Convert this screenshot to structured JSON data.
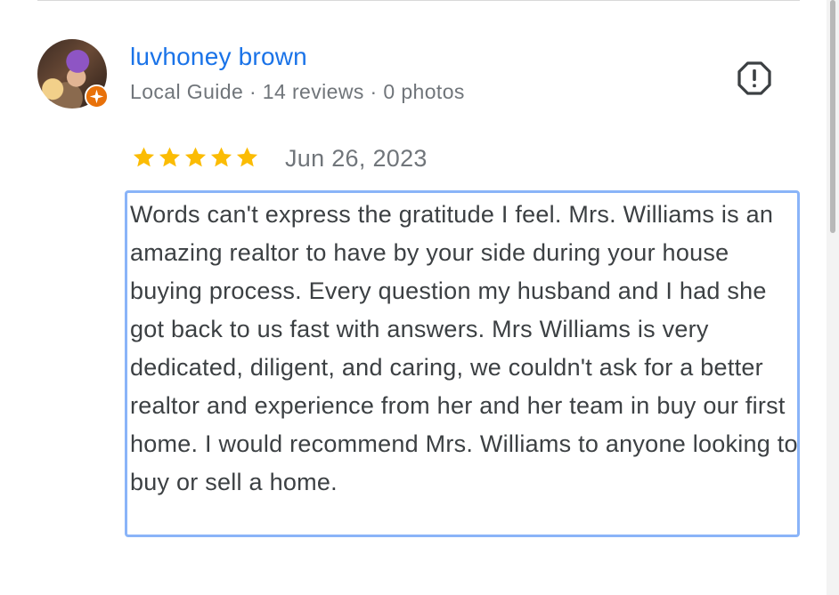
{
  "review": {
    "reviewer_name": "luvhoney brown",
    "reviewer_meta": "Local Guide · 14 reviews · 0 photos",
    "rating": 5,
    "rating_max": 5,
    "date": "Jun 26, 2023",
    "text": "Words can't express the gratitude I feel. Mrs. Williams is an amazing realtor to have by your side during your house buying process. Every question my husband and I had she got back to us fast with answers. Mrs Williams is very dedicated, diligent, and caring, we couldn't ask for a better realtor and experience from her and her team in buy our first home. I would recommend Mrs. Williams to anyone looking to buy or sell a home."
  },
  "icons": {
    "avatar": "avatar-photo",
    "badge": "local-guide-badge-icon",
    "report": "report-flag-icon",
    "star": "star-icon"
  },
  "colors": {
    "name_link": "#1a73e8",
    "meta_text": "#70757a",
    "body_text": "#3c4043",
    "star_fill": "#fbbc04",
    "guide_badge": "#e8710a",
    "focus_outline": "#8ab4f8"
  }
}
